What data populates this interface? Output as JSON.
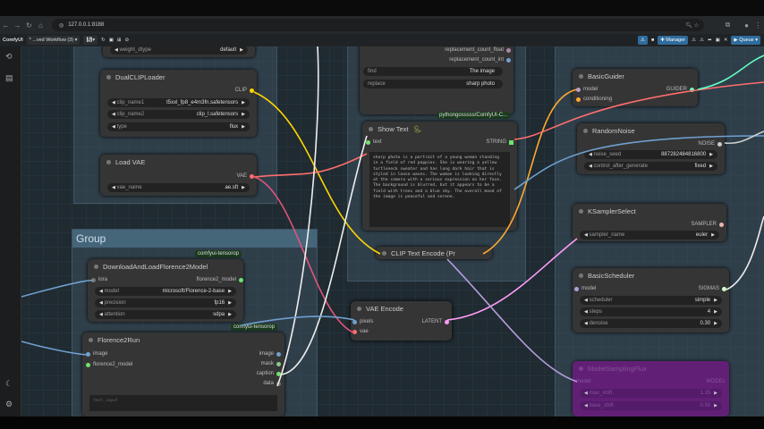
{
  "browser": {
    "url": "127.0.0.1:8188"
  },
  "menu": {
    "app": "ComfyUI",
    "workflow": "* ...ved Workflow (3)",
    "manager": "Manager",
    "queue": "Queue"
  },
  "groups": {
    "main": "Group"
  },
  "nodes": {
    "top_left": {
      "widget": "weight_dtype",
      "value": "default"
    },
    "dualclip": {
      "title": "DualCLIPLoader",
      "output": "CLIP",
      "widgets": [
        {
          "label": "clip_name1",
          "value": "t5xxl_fp8_e4m3fn.safetensors"
        },
        {
          "label": "clip_name2",
          "value": "clip_l.safetensors"
        },
        {
          "label": "type",
          "value": "flux"
        }
      ]
    },
    "loadvae": {
      "title": "Load VAE",
      "output": "VAE",
      "widget": {
        "label": "vae_name",
        "value": "ae.sft"
      }
    },
    "replace": {
      "outputs": [
        "replacement_count_float",
        "replacement_count_int"
      ],
      "find": {
        "label": "find",
        "value": "The image"
      },
      "replace": {
        "label": "replace",
        "value": "sharp photo"
      },
      "badge": "pythongosssss/ComfyUI-C..."
    },
    "showtext": {
      "title": "Show Text",
      "input": "text",
      "output": "STRING",
      "text": "sharp photo is a portrait of a young woman standing in a field of red poppies. She is wearing a yellow turtleneck sweater and has long dark hair that is styled in loose waves. The woman is looking directly at the camera with a serious expression on her face. The background is blurred, but it appears to be a field with trees and a blue sky. The overall mood of the image is peaceful and serene."
    },
    "cliptext": {
      "title": "CLIP Text Encode (Pr"
    },
    "vaeencode": {
      "title": "VAE Encode",
      "inputs": [
        "pixels",
        "vae"
      ],
      "output": "LATENT"
    },
    "florence_load": {
      "title": "DownloadAndLoadFlorence2Model",
      "badge": "comfyui-tensorop",
      "input": "lora",
      "output": "florence2_model",
      "widgets": [
        {
          "label": "model",
          "value": "microsoft/Florence-2-base"
        },
        {
          "label": "precision",
          "value": "fp16"
        },
        {
          "label": "attention",
          "value": "sdpa"
        }
      ]
    },
    "florence_run": {
      "title": "Florence2Run",
      "badge": "comfyui-tensorop",
      "inputs": [
        "image",
        "florence2_model"
      ],
      "outputs": [
        "image",
        "mask",
        "caption",
        "data"
      ],
      "placeholder": "text_input"
    },
    "guider": {
      "title": "BasicGuider",
      "inputs": [
        "model",
        "conditioning"
      ],
      "output": "GUIDER"
    },
    "noise": {
      "title": "RandomNoise",
      "output": "NOISE",
      "widgets": [
        {
          "label": "noise_seed",
          "value": "887282484816800"
        },
        {
          "label": "control_after_generate",
          "value": "fixed"
        }
      ]
    },
    "sampler": {
      "title": "KSamplerSelect",
      "output": "SAMPLER",
      "widget": {
        "label": "sampler_name",
        "value": "euler"
      }
    },
    "scheduler": {
      "title": "BasicScheduler",
      "input": "model",
      "output": "SIGMAS",
      "widgets": [
        {
          "label": "scheduler",
          "value": "simple"
        },
        {
          "label": "steps",
          "value": "4"
        },
        {
          "label": "denoise",
          "value": "0.30"
        }
      ]
    },
    "modelsampling": {
      "title": "ModelSamplingFlux",
      "input": "model",
      "output": "MODEL",
      "widgets": [
        {
          "label": "max_shift",
          "value": "1.15"
        },
        {
          "label": "base_shift",
          "value": "0.50"
        }
      ]
    }
  }
}
